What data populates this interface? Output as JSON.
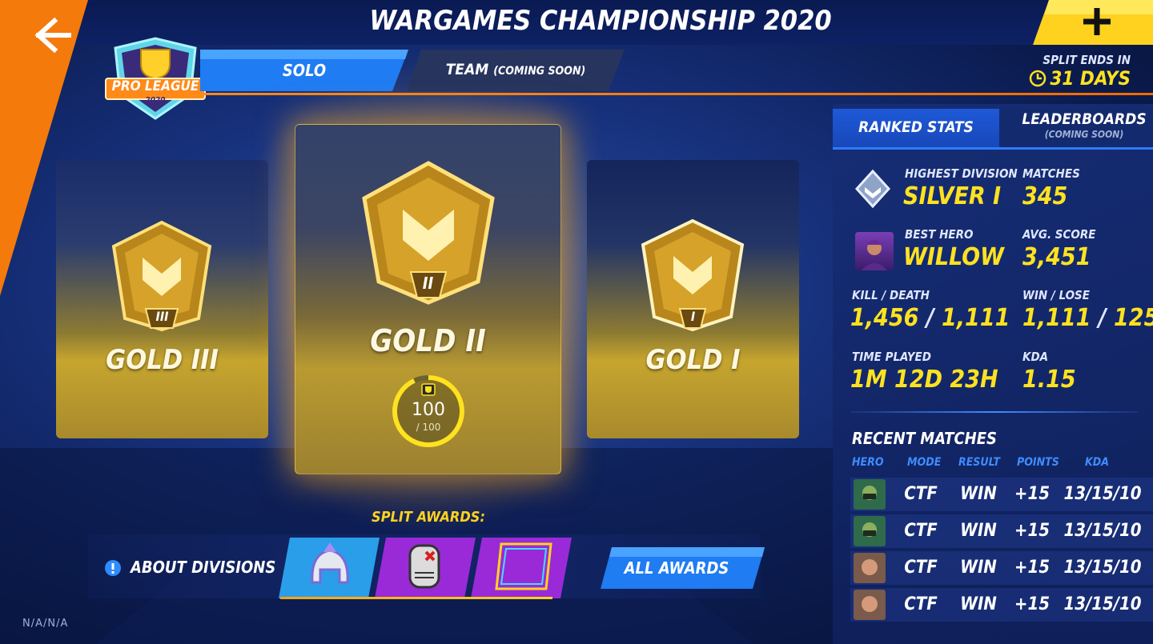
{
  "header": {
    "title": "WARGAMES CHAMPIONSHIP 2020",
    "back_icon": "arrow-left-icon",
    "plus_icon": "plus-icon"
  },
  "badge": {
    "line1": "PRO LEAGUE",
    "line2": "2020"
  },
  "tabs": {
    "solo": "SOLO",
    "team": "TEAM",
    "team_note": "(COMING SOON)"
  },
  "split": {
    "label": "SPLIT ENDS IN",
    "days": "31 DAYS"
  },
  "ranks": {
    "left": {
      "name": "GOLD III",
      "numeral": "III"
    },
    "center": {
      "name": "GOLD II",
      "numeral": "II",
      "progress": "100",
      "progress_max": "/ 100",
      "progress_fraction": 1.0
    },
    "right": {
      "name": "GOLD I",
      "numeral": "I"
    }
  },
  "panel": {
    "tab_ranked": "RANKED STATS",
    "tab_leader": "LEADERBOARDS",
    "tab_leader_note": "(COMING SOON)",
    "stats": {
      "highest_division_label": "HIGHEST DIVISION",
      "highest_division": "SILVER I",
      "matches_label": "MATCHES",
      "matches": "345",
      "best_hero_label": "BEST HERO",
      "best_hero": "WILLOW",
      "avg_score_label": "AVG. SCORE",
      "avg_score": "3,451",
      "kd_label": "KILL / DEATH",
      "kills": "1,456",
      "deaths": "1,111",
      "wl_label": "WIN / LOSE",
      "wins": "1,111",
      "losses": "125",
      "time_label": "TIME PLAYED",
      "time": "1M 12D 23H",
      "kda_label": "KDA",
      "kda": "1.15"
    },
    "recent": {
      "title": "RECENT MATCHES",
      "columns": [
        "HERO",
        "MODE",
        "RESULT",
        "POINTS",
        "KDA"
      ],
      "rows": [
        {
          "mode": "CTF",
          "result": "WIN",
          "points": "+15",
          "kda": "13/15/10"
        },
        {
          "mode": "CTF",
          "result": "WIN",
          "points": "+15",
          "kda": "13/15/10"
        },
        {
          "mode": "CTF",
          "result": "WIN",
          "points": "+15",
          "kda": "13/15/10"
        },
        {
          "mode": "CTF",
          "result": "WIN",
          "points": "+15",
          "kda": "13/15/10"
        }
      ]
    }
  },
  "bottom": {
    "split_awards": "SPLIT AWARDS:",
    "about": "ABOUT DIVISIONS",
    "all_awards": "ALL AWARDS",
    "na": "N/A/N/A"
  },
  "colors": {
    "accent_yellow": "#ffe21f",
    "accent_orange": "#f26b00",
    "accent_blue": "#1e59d8"
  }
}
